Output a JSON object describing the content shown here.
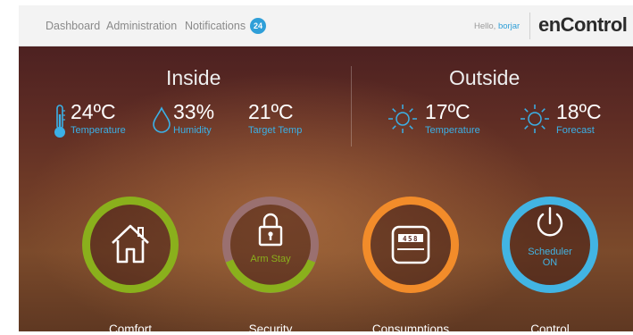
{
  "nav": {
    "dashboard": "Dashboard",
    "administration": "Administration",
    "notifications": "Notifications",
    "notification_count": "24"
  },
  "user": {
    "greeting": "Hello,",
    "username": "borjar"
  },
  "logo": "enControl",
  "inside": {
    "title": "Inside",
    "temperature": {
      "value": "24ºC",
      "label": "Temperature"
    },
    "humidity": {
      "value": "33%",
      "label": "Humidity"
    },
    "target_temp": {
      "value": "21ºC",
      "label": "Target Temp"
    }
  },
  "outside": {
    "title": "Outside",
    "temperature": {
      "value": "17ºC",
      "label": "Temperature"
    },
    "forecast": {
      "value": "18ºC",
      "label": "Forecast"
    }
  },
  "tiles": {
    "comfort": {
      "label": "Comfort",
      "ring_color": "#8ab01c"
    },
    "security": {
      "label": "Security",
      "status": "Arm Stay",
      "ring_color": "#8ab01c",
      "ring_track_color": "#9a7070"
    },
    "consumptions": {
      "label": "Consumptions",
      "meter_digits": "458",
      "ring_color": "#f28c2a"
    },
    "control": {
      "label": "Control",
      "status_line1": "Scheduler",
      "status_line2": "ON",
      "ring_color": "#42b4e3"
    }
  },
  "colors": {
    "accent": "#3bb0e6",
    "badge": "#2f9fd8"
  }
}
